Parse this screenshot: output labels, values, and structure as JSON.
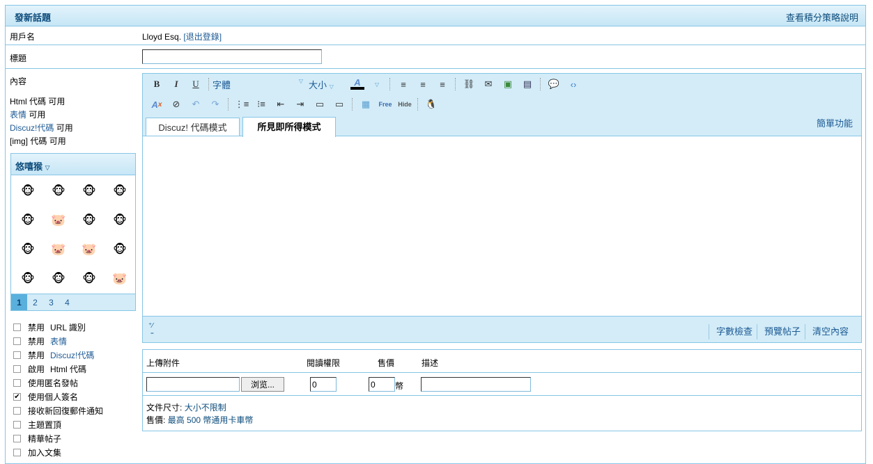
{
  "header": {
    "title": "發新話題",
    "help_link": "查看積分策略說明"
  },
  "username": {
    "label": "用戶名",
    "value": "Lloyd Esq.",
    "logout": "[退出登錄]"
  },
  "subject": {
    "label": "標題",
    "value": ""
  },
  "content": {
    "label": "內容",
    "codes": [
      {
        "name": "Html 代碼",
        "status": "可用",
        "link": false
      },
      {
        "name": "表情",
        "status": "可用",
        "link": true
      },
      {
        "name": "Discuz!代碼",
        "status": "可用",
        "link": true
      },
      {
        "name": "[img] 代碼",
        "status": "可用",
        "link": false
      }
    ]
  },
  "smilies": {
    "title": "悠嘻猴",
    "faces": [
      "🐵",
      "🐵",
      "🐵",
      "🐵",
      "🐵",
      "🐷",
      "🐵",
      "🐵",
      "🐵",
      "🐷",
      "🐷",
      "🐵",
      "🐵",
      "🐵",
      "🐵",
      "🐷"
    ],
    "pages": [
      "1",
      "2",
      "3",
      "4"
    ],
    "current": "1"
  },
  "options": [
    {
      "pre": "禁用",
      "text": "URL 識別",
      "link": false,
      "checked": false
    },
    {
      "pre": "禁用",
      "text": "表情",
      "link": true,
      "checked": false
    },
    {
      "pre": "禁用",
      "text": "Discuz!代碼",
      "link": true,
      "checked": false
    },
    {
      "pre": "啟用",
      "text": "Html 代碼",
      "link": false,
      "checked": false
    },
    {
      "pre": "",
      "text": "使用匿名發帖",
      "link": false,
      "checked": false
    },
    {
      "pre": "",
      "text": "使用個人簽名",
      "link": false,
      "checked": true
    },
    {
      "pre": "",
      "text": "接收新回復郵件通知",
      "link": false,
      "checked": false
    },
    {
      "pre": "",
      "text": "主題置頂",
      "link": false,
      "checked": false
    },
    {
      "pre": "",
      "text": "精華帖子",
      "link": false,
      "checked": false
    },
    {
      "pre": "",
      "text": "加入文集",
      "link": false,
      "checked": false
    }
  ],
  "editor": {
    "font_label": "字體",
    "size_label": "大小",
    "tab_code": "Discuz! 代碼模式",
    "tab_wysiwyg": "所見即所得模式",
    "simple_mode": "簡單功能",
    "word_count": "字數檢查",
    "preview": "預覽帖子",
    "clear": "清空內容"
  },
  "attachment": {
    "col_upload": "上傳附件",
    "col_perm": "閱讀權限",
    "col_price": "售價",
    "col_desc": "描述",
    "browse": "浏览...",
    "perm_value": "0",
    "price_value": "0",
    "currency": "幣",
    "size_label": "文件尺寸:",
    "size_value": "大小不限制",
    "price_label": "售價:",
    "price_info": "最高 500 幣通用卡車幣"
  }
}
